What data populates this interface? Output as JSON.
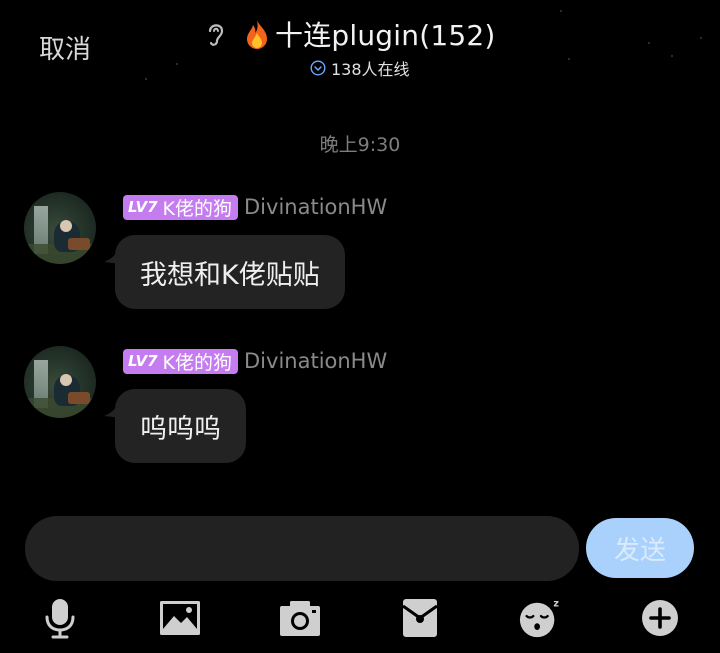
{
  "header": {
    "cancel_label": "取消",
    "title": "十连plugin(152)",
    "online_text": "138人在线"
  },
  "timestamp": "晚上9:30",
  "messages": [
    {
      "level": "LV7",
      "title": "K佬的狗",
      "nick": "DivinationHW",
      "text": "我想和K佬贴贴"
    },
    {
      "level": "LV7",
      "title": "K佬的狗",
      "nick": "DivinationHW",
      "text": "呜呜呜"
    }
  ],
  "input": {
    "value": "",
    "send_label": "发送"
  },
  "toolbar": {
    "icons": [
      "microphone-icon",
      "image-icon",
      "camera-icon",
      "red-packet-icon",
      "emoji-icon",
      "plus-icon"
    ]
  },
  "colors": {
    "background": "#000000",
    "bubble": "#232323",
    "badge": "#c47cf0",
    "send_button": "#a9d1fb",
    "input": "#222222"
  }
}
